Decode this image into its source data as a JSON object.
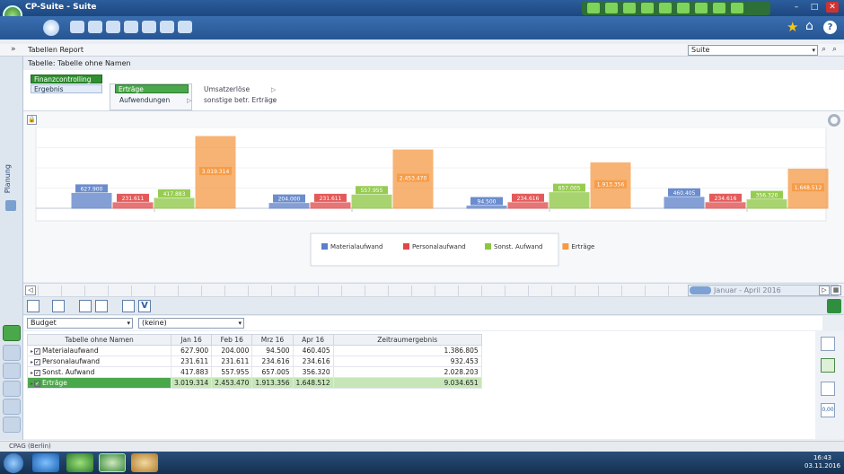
{
  "window": {
    "title": "CP-Suite - Suite"
  },
  "report": {
    "name": "Tabellen Report",
    "suite_select": "Suite"
  },
  "table_title": "Tabelle: Tabelle ohne Namen",
  "leftnav": {
    "label": "Planung"
  },
  "tree": {
    "root": "Finanzcontrolling",
    "child": "Ergebnis",
    "level2": [
      "Erträge",
      "Aufwendungen"
    ],
    "level3": [
      "Umsatzerlöse",
      "sonstige betr. Erträge"
    ]
  },
  "chart_data": {
    "type": "bar",
    "categories": [
      "Jan 16",
      "Feb 16",
      "Mrz 16",
      "Apr 16"
    ],
    "series": [
      {
        "name": "Materialaufwand",
        "color": "#5b7fc8",
        "values": [
          627.9,
          204.0,
          94.5,
          460.405
        ]
      },
      {
        "name": "Personalaufwand",
        "color": "#e04848",
        "values": [
          231.611,
          231.611,
          234.616,
          234.616
        ]
      },
      {
        "name": "Sonst. Aufwand",
        "color": "#8cc63f",
        "values": [
          417.883,
          557.955,
          657.005,
          356.32
        ]
      },
      {
        "name": "Erträge",
        "color": "#f59a45",
        "values": [
          3019.314,
          2453.47,
          1913.356,
          1648.512
        ]
      }
    ],
    "data_labels": [
      [
        "627.900",
        "231.611",
        "417.883",
        "3.019.314"
      ],
      [
        "204.000",
        "231.611",
        "557.955",
        "2.453.470"
      ],
      [
        "94.500",
        "234.616",
        "657.005",
        "1.913.356"
      ],
      [
        "460.405",
        "234.616",
        "356.320",
        "1.648.512"
      ]
    ],
    "legend_position": "bottom-center"
  },
  "timeline": {
    "period": "Januar - April 2016"
  },
  "selects": {
    "version": "Budget",
    "filter": "(keine)"
  },
  "grid": {
    "columns": [
      "Tabelle ohne Namen",
      "Jan 16",
      "Feb 16",
      "Mrz 16",
      "Apr 16",
      "Zeitraumergebnis"
    ],
    "rows": [
      {
        "label": "Materialaufwand",
        "cells": [
          "627.900",
          "204.000",
          "94.500",
          "460.405",
          "1.386.805"
        ]
      },
      {
        "label": "Personalaufwand",
        "cells": [
          "231.611",
          "231.611",
          "234.616",
          "234.616",
          "932.453"
        ]
      },
      {
        "label": "Sonst. Aufwand",
        "cells": [
          "417.883",
          "557.955",
          "657.005",
          "356.320",
          "2.028.203"
        ]
      },
      {
        "label": "Erträge",
        "cells": [
          "3.019.314",
          "2.453.470",
          "1.913.356",
          "1.648.512",
          "9.034.651"
        ]
      }
    ]
  },
  "rightcol": {
    "decimals_button": "0,00"
  },
  "status": {
    "text": "CPAG (Berlin)"
  },
  "clock": {
    "time": "16:43",
    "date": "03.11.2016"
  },
  "colors": {
    "accent_green": "#4aa84a",
    "title_blue": "#2b5d9c"
  }
}
